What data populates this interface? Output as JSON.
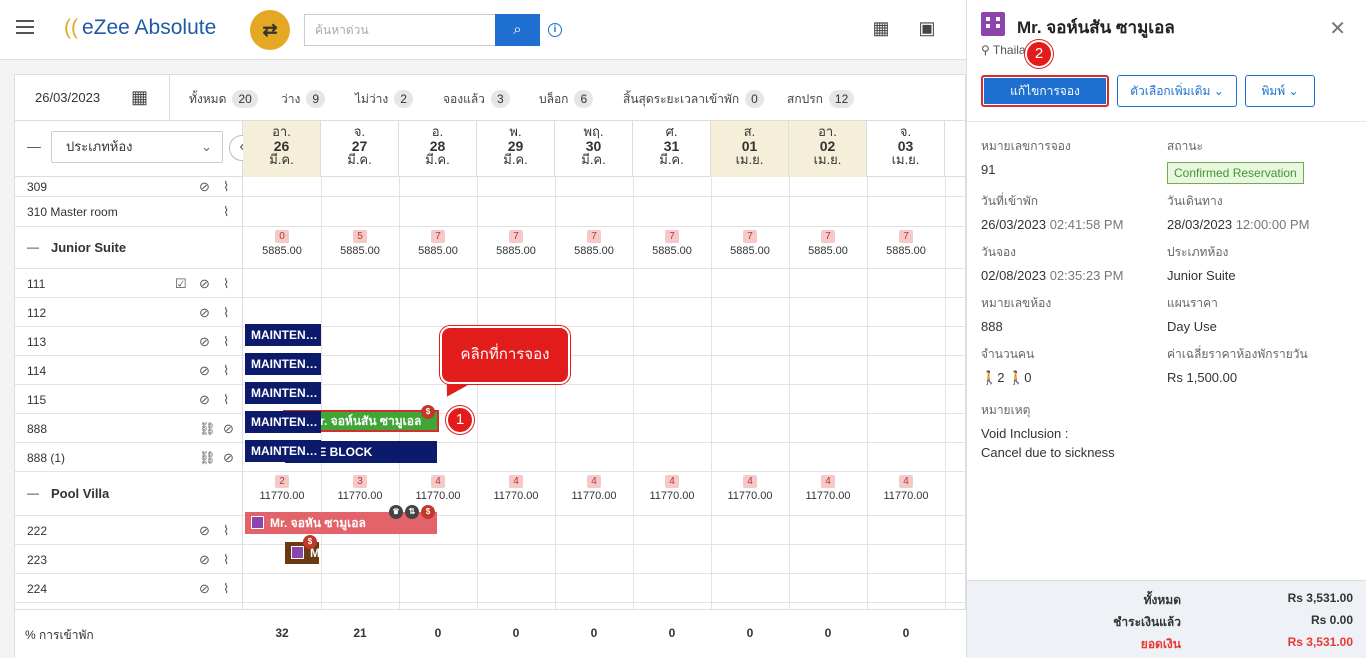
{
  "app": {
    "logo": "eZee Absolute",
    "search_placeholder": "ค้นหาด่วน"
  },
  "stats": {
    "date": "26/03/2023",
    "items": [
      {
        "label": "ทั้งหมด",
        "count": "20"
      },
      {
        "label": "ว่าง",
        "count": "9"
      },
      {
        "label": "ไม่ว่าง",
        "count": "2"
      },
      {
        "label": "จองแล้ว",
        "count": "3"
      },
      {
        "label": "บล็อก",
        "count": "6"
      },
      {
        "label": "สิ้นสุดระยะเวลาเข้าพัก",
        "count": "0"
      },
      {
        "label": "สกปรก",
        "count": "12"
      }
    ]
  },
  "grid": {
    "room_type_select": "ประเภทห้อง",
    "days": [
      {
        "dow": "อา.",
        "day": "26",
        "mon": "มี.ค."
      },
      {
        "dow": "จ.",
        "day": "27",
        "mon": "มี.ค."
      },
      {
        "dow": "อ.",
        "day": "28",
        "mon": "มี.ค."
      },
      {
        "dow": "พ.",
        "day": "29",
        "mon": "มี.ค."
      },
      {
        "dow": "พฤ.",
        "day": "30",
        "mon": "มี.ค."
      },
      {
        "dow": "ศ.",
        "day": "31",
        "mon": "มี.ค."
      },
      {
        "dow": "ส.",
        "day": "01",
        "mon": "เม.ย."
      },
      {
        "dow": "อา.",
        "day": "02",
        "mon": "เม.ย."
      },
      {
        "dow": "จ.",
        "day": "03",
        "mon": "เม.ย."
      }
    ],
    "rooms_top": [
      "309",
      "310 Master room"
    ],
    "junior": {
      "name": "Junior Suite",
      "avail": [
        "0",
        "5",
        "7",
        "7",
        "7",
        "7",
        "7",
        "7",
        "7"
      ],
      "rate": "5885.00",
      "rooms": [
        "111",
        "112",
        "113",
        "114",
        "115",
        "888",
        "888 (1)"
      ]
    },
    "pool": {
      "name": "Pool Villa",
      "avail": [
        "2",
        "3",
        "4",
        "4",
        "4",
        "4",
        "4",
        "4",
        "4"
      ],
      "rate": "11770.00",
      "rooms": [
        "222",
        "223",
        "224"
      ]
    },
    "maint_label": "MAINTEN…",
    "booking_green": "Mr. จอห์นสัน ซามูเอล",
    "suite_block": "SUITE BLOCK",
    "booking_pink": "Mr. จอหัน ซามูเอล",
    "booking_brown": "M",
    "occupancy_label": "% การเข้าพัก",
    "occupancy": [
      "32",
      "21",
      "0",
      "0",
      "0",
      "0",
      "0",
      "0",
      "0"
    ]
  },
  "annotations": {
    "callout": "คลิกที่การจอง",
    "step1": "1",
    "step2": "2"
  },
  "panel": {
    "title": "Mr. จอห์นสัน ซามูเอล",
    "location": "Thailand",
    "edit_button": "แก้ไขการจอง",
    "more_button": "ตัวเลือกเพิ่มเติม",
    "print_button": "พิมพ์",
    "fields": {
      "res_no_k": "หมายเลขการจอง",
      "res_no_v": "91",
      "status_k": "สถานะ",
      "status_v": "Confirmed Reservation",
      "checkin_k": "วันที่เข้าพัก",
      "checkin_v": "26/03/2023",
      "checkin_t": "02:41:58 PM",
      "checkout_k": "วันเดินทาง",
      "checkout_v": "28/03/2023",
      "checkout_t": "12:00:00 PM",
      "booked_k": "วันจอง",
      "booked_v": "02/08/2023",
      "booked_t": "02:35:23 PM",
      "roomtype_k": "ประเภทห้อง",
      "roomtype_v": "Junior Suite",
      "roomno_k": "หมายเลขห้อง",
      "roomno_v": "888",
      "rateplan_k": "แผนราคา",
      "rateplan_v": "Day Use",
      "pax_k": "จำนวนคน",
      "adults": "2",
      "children": "0",
      "avg_k": "ค่าเฉลี่ยราคาห้องพักรายวัน",
      "avg_v": "Rs 1,500.00",
      "note_k": "หมายเหตุ",
      "note_1": "Void Inclusion :",
      "note_2": "Cancel due to sickness"
    },
    "totals": [
      {
        "label": "ทั้งหมด",
        "value": "Rs 3,531.00"
      },
      {
        "label": "ชำระเงินแล้ว",
        "value": "Rs 0.00"
      },
      {
        "label": "ยอดเงิน",
        "value": "Rs 3,531.00"
      }
    ],
    "balance_color": "#e53935"
  }
}
